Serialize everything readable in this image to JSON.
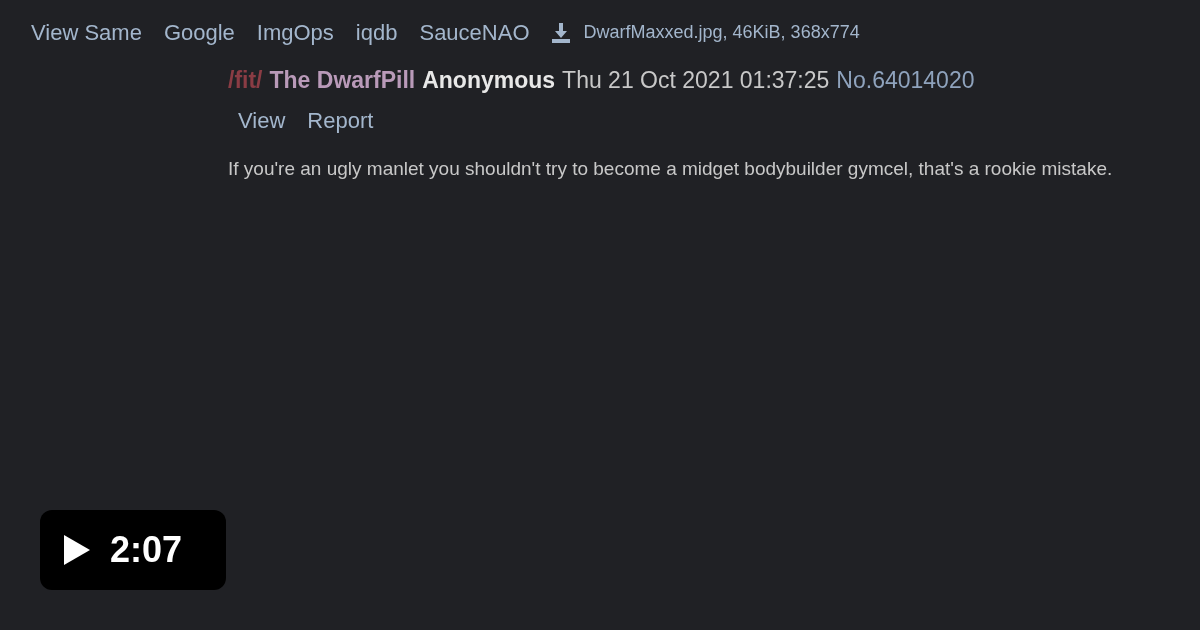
{
  "image_links": [
    "View Same",
    "Google",
    "ImgOps",
    "iqdb",
    "SauceNAO"
  ],
  "file": {
    "name": "DwarfMaxxed.jpg",
    "info": ", 46KiB, 368x774"
  },
  "post": {
    "board": "/fit/",
    "subject": "The DwarfPill",
    "name": "Anonymous",
    "date": "Thu 21 Oct 2021 01:37:25",
    "number": "No.64014020",
    "actions": [
      "View",
      "Report"
    ],
    "message": "If you're an ugly manlet you shouldn't try to become a midget bodybuilder gymcel, that's a rookie mistake."
  },
  "video_badge": {
    "duration": "2:07"
  }
}
